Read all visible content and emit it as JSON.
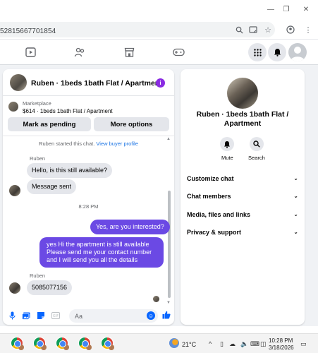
{
  "browser": {
    "url": "52815667701854"
  },
  "chat": {
    "header_title": "Ruben · 1beds 1bath Flat / Apartment",
    "marketplace_label": "Marketplace",
    "listing": "$614 · 1beds 1bath Flat / Apartment",
    "mark_pending_label": "Mark as pending",
    "more_options_label": "More options",
    "system_text": "Ruben started this chat.",
    "system_link": "View buyer profile",
    "sender_name": "Ruben",
    "messages_in_1": [
      "Hello, is this still available?",
      "Message sent"
    ],
    "timestamp": "8:28 PM",
    "out_1": "Yes, are you interested?",
    "out_2_lines": [
      "yes Hi the apartment is still available",
      "Please send me your contact number",
      "and I will send you all the details"
    ],
    "sender_name_2": "Ruben",
    "in_2": "5085077156",
    "composer_placeholder": "Aa"
  },
  "info": {
    "title_line1": "Ruben · 1beds 1bath Flat /",
    "title_line2": "Apartment",
    "mute_label": "Mute",
    "search_label": "Search",
    "sections": [
      "Customize chat",
      "Chat members",
      "Media, files and links",
      "Privacy & support"
    ]
  },
  "taskbar": {
    "temperature": "21°C",
    "time": "10:28 PM",
    "date": "3/18/2026"
  },
  "colors": {
    "outgoing_bubble": "#6b49e4",
    "accent_blue": "#0866ff",
    "info_purple": "#8a2be2"
  }
}
